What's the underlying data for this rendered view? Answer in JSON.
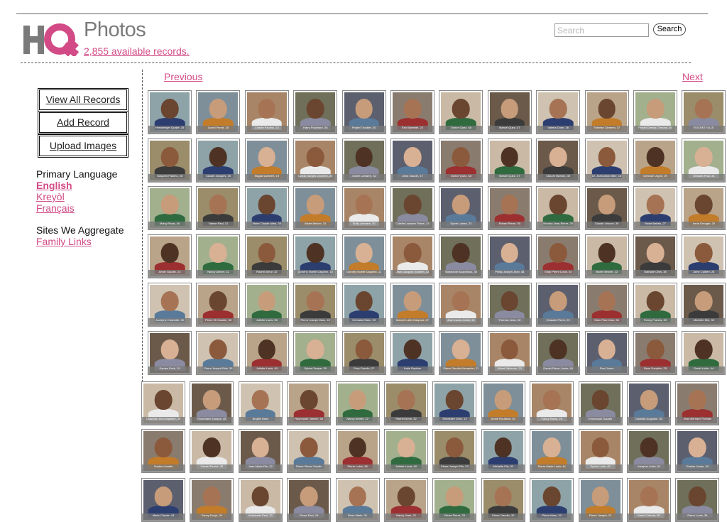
{
  "header": {
    "logo_text": "HQ",
    "title": "Photos",
    "record_count": "2,855 available records.",
    "search_placeholder": "Search",
    "search_button": "Search"
  },
  "sidebar": {
    "buttons": [
      "View All Records",
      "Add Record",
      "Upload Images"
    ],
    "language_heading": "Primary Language",
    "languages": [
      "English",
      "Kreyòl",
      "Français"
    ],
    "active_language": "English",
    "sites_heading": "Sites We Aggregate",
    "sites": [
      "Family Links"
    ]
  },
  "pager": {
    "previous": "Previous",
    "next": "Next"
  },
  "colors": {
    "accent": "#d24b86",
    "logo_gray": "#7a7a7a"
  },
  "gallery": {
    "rows": [
      {
        "count": 12,
        "captions": [
          "Hertzberger Quaile, 25",
          "Lionel Ferrat, 18",
          "Charlie Paulino, 10",
          "Harry Paulinard, 58",
          "Pradel Trouillet, 30",
          "Eric Barbette, 22",
          "Dorice Quez, 48",
          "Marcel Quez, 47",
          "Valeria Dunn, 26",
          "Thérèse Clement, 37",
          "Pradel Derrick Ormond, 46",
          "ROCHET VILLE"
        ]
      },
      {
        "count": 12,
        "captions": [
          "Gaspard Paulino, 28",
          "Claude Jacques, 30",
          "Magali Lambert, 19",
          "Lynda Gorges Lhomme, 25",
          "Josele Lamarre, 32",
          "Jean Claude, 47",
          "Dorice Quez, 48",
          "Marcel Quez, 47",
          "Claude Manton, 35",
          "Dr. Jean-Marc Mike, 18",
          "Deborah Joyce, 29",
          "Ghislain Paul, 33"
        ]
      },
      {
        "count": 12,
        "captions": [
          "Moisy Rivas, 40",
          "Yolene Paul, 21",
          "Marie Claude Allea, 38",
          "Albert Bellom, 31",
          "Eddy Lamarre, 30",
          "Colette Lamarre Pierre, 13",
          "Sylvie Laissé, 22",
          "Robert Pierre, 50",
          "Nicoley Jean-Pierre, 26",
          "Claude Léonce, 39",
          "Rosie Bellais, 27",
          "Irene Georgie, 29"
        ]
      },
      {
        "count": 12,
        "captions": [
          "Annie Gaudin, 23",
          "Nancy Amber, 22",
          "Rachel Amor, 32",
          "Dorothy Noelle Dauphin, 10",
          "Dorothy Noelle Dauphin, 11",
          "Jean Jacques Guilbert, 33",
          "Stephanie Bourdeaux, 35",
          "Phillip Joseph Jean, 48",
          "Eddy Pierre Louis, 44",
          "Marie Mercier, 22",
          "Nathalie Celis, 38",
          "Anne Colbert, 28"
        ]
      },
      {
        "count": 12,
        "captions": [
          "Jocelyne Charlotte, 23",
          "Pierre Eli Gaudin, 38",
          "Juliette Louis, 55",
          "Pierre Joseph Marc, 45",
          "Gervaise Marc, 33",
          "Marcel Lubin Gaspard, 27",
          "Jean Lucas Jones, 51",
          "Therese Jean, 30",
          "Chasele Pierre, 29",
          "Marc Paul Jean, 66",
          "Fanny Francis, 30",
          "Michelle Elie, 33"
        ]
      },
      {
        "count": 12,
        "captions": [
          "Danise Erick, 25",
          "Pierre Joseph Rick, 35",
          "Juliette Louis, 40",
          "Sylvia Gaspar, 35",
          "Grey Gaudin, 27",
          "Katie Daphne",
          "Pierre Gaudin Alexander, 21",
          "Albert Salomon, 23",
          "Daniel Pierre Junior, 60",
          "Paul Jones",
          "Rose Dauphin, 25",
          "David Lubin, 44"
        ]
      },
      {
        "count": 12,
        "captions": [
          "Charlotte Jean-Baptiste, 25",
          "Rosemarie Darque, 46",
          "Brigitte Blain",
          "Raymonde Jasmin, 55",
          "Nancy Amber, 22",
          "Rachel Amor, 32",
          "Sebastien Jean, 13",
          "Annie Roulland, 30",
          "Fanny Raoul, 25",
          "Emmanuel Gaudin",
          "Danielle Augustin, 35",
          "Jean-Bernard Thomas"
        ]
      },
      {
        "count": 12,
        "captions": [
          "Sophie Lavalle",
          "Gerald Perriot, 35",
          "Jean-Marie Fils, 22",
          "Pierre Pierre Gaudin",
          "Pierre Lubin, 38",
          "Juliette Louis, 40",
          "Pierre Joseph Fils, 23",
          "Michelle Fils, 33",
          "Pierre Marie Louis, 44",
          "Sylvie Louis, 45",
          "Josephe Lubin, 62",
          "Rosine Jonas, 45"
        ]
      },
      {
        "count": 12,
        "captions": [
          "Marie Claude, 43",
          "Fanny Dorys, 33",
          "Antoinette Paul, 33",
          "Pierre Paul, 25",
          "Rose Marie, 31",
          "Nancy Jean, 22",
          "Pierre Pierre, 25",
          "Pierre Gaudin, 30",
          "Pierre Marc, 22",
          "Pierre Joseph, 22",
          "Marie Celeste, 55",
          "Pierre Louis, 38"
        ]
      }
    ]
  }
}
